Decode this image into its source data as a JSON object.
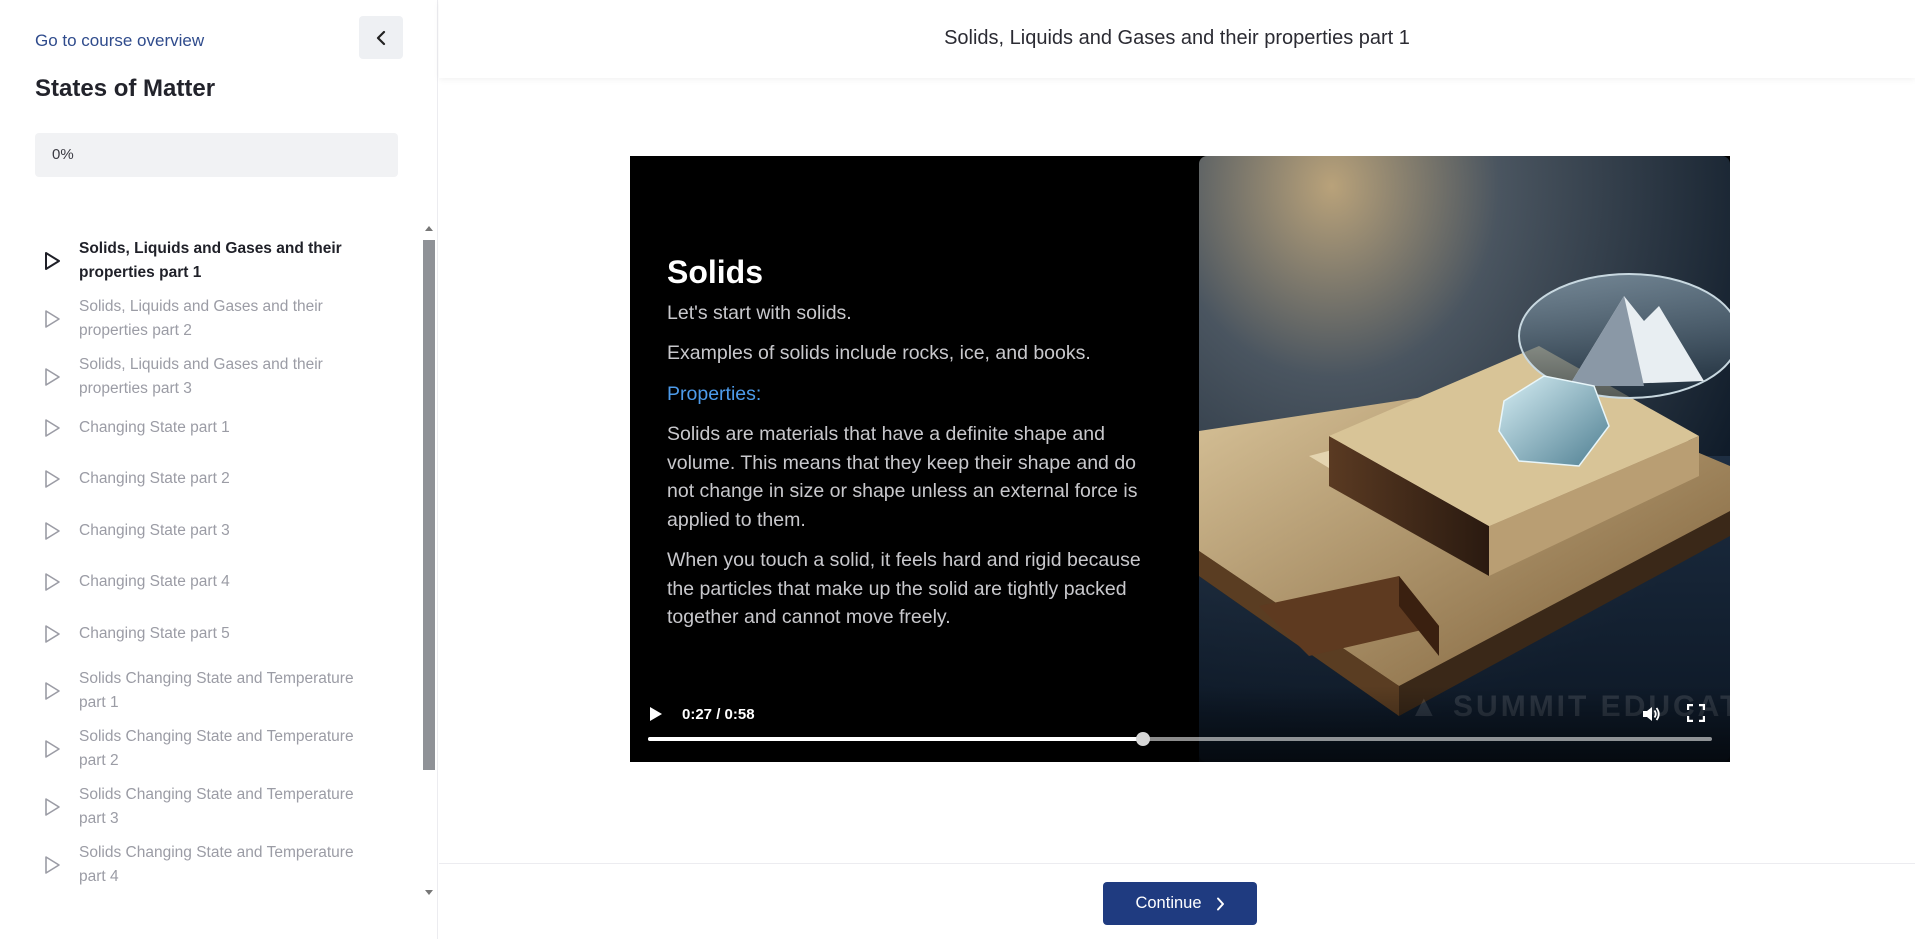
{
  "sidebar": {
    "course_link": "Go to course overview",
    "course_title": "States of Matter",
    "progress": "0%",
    "progress_value": 0,
    "lessons": [
      {
        "label": "Solids, Liquids and Gases and their properties part 1",
        "active": true
      },
      {
        "label": "Solids, Liquids and Gases and their properties part 2",
        "active": false
      },
      {
        "label": "Solids, Liquids and Gases and their properties part 3",
        "active": false
      },
      {
        "label": "Changing State part 1",
        "active": false
      },
      {
        "label": "Changing State part 2",
        "active": false
      },
      {
        "label": "Changing State part 3",
        "active": false
      },
      {
        "label": "Changing State part 4",
        "active": false
      },
      {
        "label": "Changing State part 5",
        "active": false
      },
      {
        "label": "Solids Changing State and Temperature part 1",
        "active": false
      },
      {
        "label": "Solids Changing State and Temperature part 2",
        "active": false
      },
      {
        "label": "Solids Changing State and Temperature part 3",
        "active": false
      },
      {
        "label": "Solids Changing State and Temperature part 4",
        "active": false
      }
    ]
  },
  "header": {
    "lesson_title": "Solids, Liquids and Gases and their properties part 1"
  },
  "video": {
    "slide": {
      "heading": "Solids",
      "p1": "Let's start with solids.",
      "p2": "Examples of solids include rocks, ice, and books.",
      "subheading": "Properties:",
      "p3": "Solids are materials that have a definite shape and volume. This means that they keep their shape and do not change in size or shape unless an external force is applied to them.",
      "p4": "When you touch a solid, it feels hard and rigid because the particles that make up the solid are tightly packed together and cannot move freely."
    },
    "time_display": "0:27 / 0:58",
    "progress_fraction": 0.4655
  },
  "footer": {
    "continue_label": "Continue"
  },
  "colors": {
    "brand": "#1f3b80",
    "link": "#2f4b8c",
    "slide_accent": "#4d9bea"
  }
}
